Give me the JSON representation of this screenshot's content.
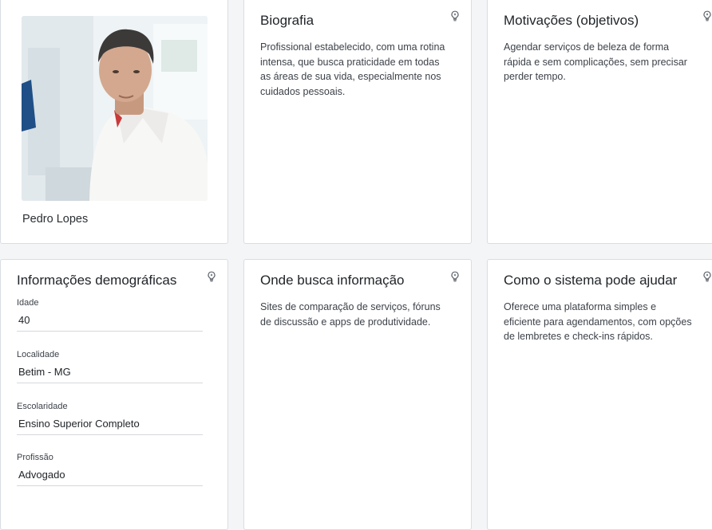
{
  "persona": {
    "name": "Pedro Lopes"
  },
  "biography": {
    "title": "Biografia",
    "text": "Profissional estabelecido, com uma rotina intensa, que busca praticidade em todas as áreas de sua vida, especialmente nos cuidados pessoais."
  },
  "motivations": {
    "title": "Motivações (objetivos)",
    "text": "Agendar serviços de beleza de forma rápida e sem complicações, sem precisar perder tempo."
  },
  "demographics": {
    "title": "Informações demográficas",
    "fields": [
      {
        "label": "Idade",
        "value": "40"
      },
      {
        "label": "Localidade",
        "value": "Betim - MG"
      },
      {
        "label": "Escolaridade",
        "value": "Ensino Superior Completo"
      },
      {
        "label": "Profissão",
        "value": "Advogado"
      }
    ]
  },
  "info_sources": {
    "title": "Onde busca informação",
    "text": "Sites de comparação de serviços, fóruns de discussão e apps de produtividade."
  },
  "system_help": {
    "title": "Como o sistema pode ajudar",
    "text": "Oferece uma plataforma simples e eficiente para agendamentos, com opções de lembretes e check-ins rápidos."
  },
  "icons": {
    "hint": "lightbulb-icon"
  },
  "colors": {
    "background": "#f4f5f7",
    "card": "#ffffff",
    "border": "#d9dde2",
    "text": "#212529"
  }
}
